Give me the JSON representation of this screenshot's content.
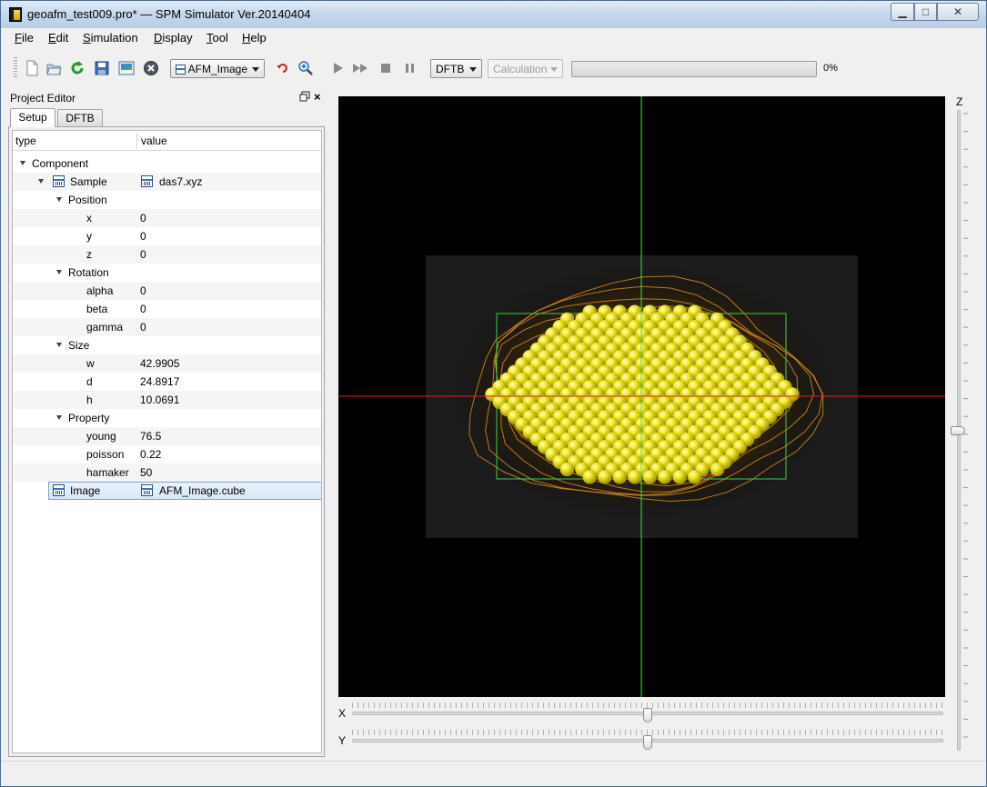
{
  "window": {
    "title": "geoafm_test009.pro* — SPM Simulator Ver.20140404",
    "controls": {
      "minimize": "▁",
      "maximize": "□",
      "close": "✕"
    }
  },
  "menu": [
    "File",
    "Edit",
    "Simulation",
    "Display",
    "Tool",
    "Help"
  ],
  "menu_mnemonics": [
    "F",
    "E",
    "S",
    "D",
    "T",
    "H"
  ],
  "toolbar": {
    "icons": [
      "new-file-icon",
      "open-folder-icon",
      "refresh-icon",
      "save-icon",
      "export-image-icon",
      "stop-circle-icon"
    ],
    "image_combo": "AFM_Image",
    "image_combo_icon": "file-icon",
    "undo_icon": "undo-icon",
    "zoom_icon": "zoom-in-icon",
    "playback_icons": [
      "play-icon",
      "fast-forward-icon",
      "stop-icon",
      "pause-icon"
    ],
    "mode_combo": "DFTB",
    "calc_combo": "Calculation",
    "progress_fraction": 0,
    "progress_label": "0%"
  },
  "project_editor": {
    "title": "Project Editor",
    "float_icon": "float-window-icon",
    "close_icon": "×",
    "tabs": [
      "Setup",
      "DFTB"
    ],
    "active_tab": "Setup",
    "columns": {
      "type": "type",
      "value": "value"
    },
    "rows": [
      {
        "label": "Component",
        "value": "",
        "level": 0,
        "expander": true
      },
      {
        "label": "Sample",
        "value": "das7.xyz",
        "level": 1,
        "expander": true,
        "icon": true,
        "value_icon": true
      },
      {
        "label": "Position",
        "value": "",
        "level": 2,
        "expander": true
      },
      {
        "label": "x",
        "value": "0",
        "level": 3
      },
      {
        "label": "y",
        "value": "0",
        "level": 3
      },
      {
        "label": "z",
        "value": "0",
        "level": 3
      },
      {
        "label": "Rotation",
        "value": "",
        "level": 2,
        "expander": true
      },
      {
        "label": "alpha",
        "value": "0",
        "level": 3
      },
      {
        "label": "beta",
        "value": "0",
        "level": 3
      },
      {
        "label": "gamma",
        "value": "0",
        "level": 3
      },
      {
        "label": "Size",
        "value": "",
        "level": 2,
        "expander": true
      },
      {
        "label": "w",
        "value": "42.9905",
        "level": 3
      },
      {
        "label": "d",
        "value": "24.8917",
        "level": 3
      },
      {
        "label": "h",
        "value": "10.0691",
        "level": 3
      },
      {
        "label": "Property",
        "value": "",
        "level": 2,
        "expander": true
      },
      {
        "label": "young",
        "value": "76.5",
        "level": 3
      },
      {
        "label": "poisson",
        "value": "0.22",
        "level": 3
      },
      {
        "label": "hamaker",
        "value": "50",
        "level": 3
      },
      {
        "label": "Image",
        "value": "AFM_Image.cube",
        "level": 1,
        "icon": true,
        "value_icon": true,
        "selected": true
      }
    ]
  },
  "view": {
    "z_label": "Z",
    "x_label": "X",
    "y_label": "Y",
    "x_slider_fraction": 0.5,
    "y_slider_fraction": 0.5,
    "z_slider_fraction": 0.5,
    "colors": {
      "crosshair_vertical": "#3fe23f",
      "crosshair_horizontal": "#e02020",
      "atoms": "#e8e010",
      "contours": "#d98a1e",
      "scan_area": "#1e1e1e"
    }
  }
}
